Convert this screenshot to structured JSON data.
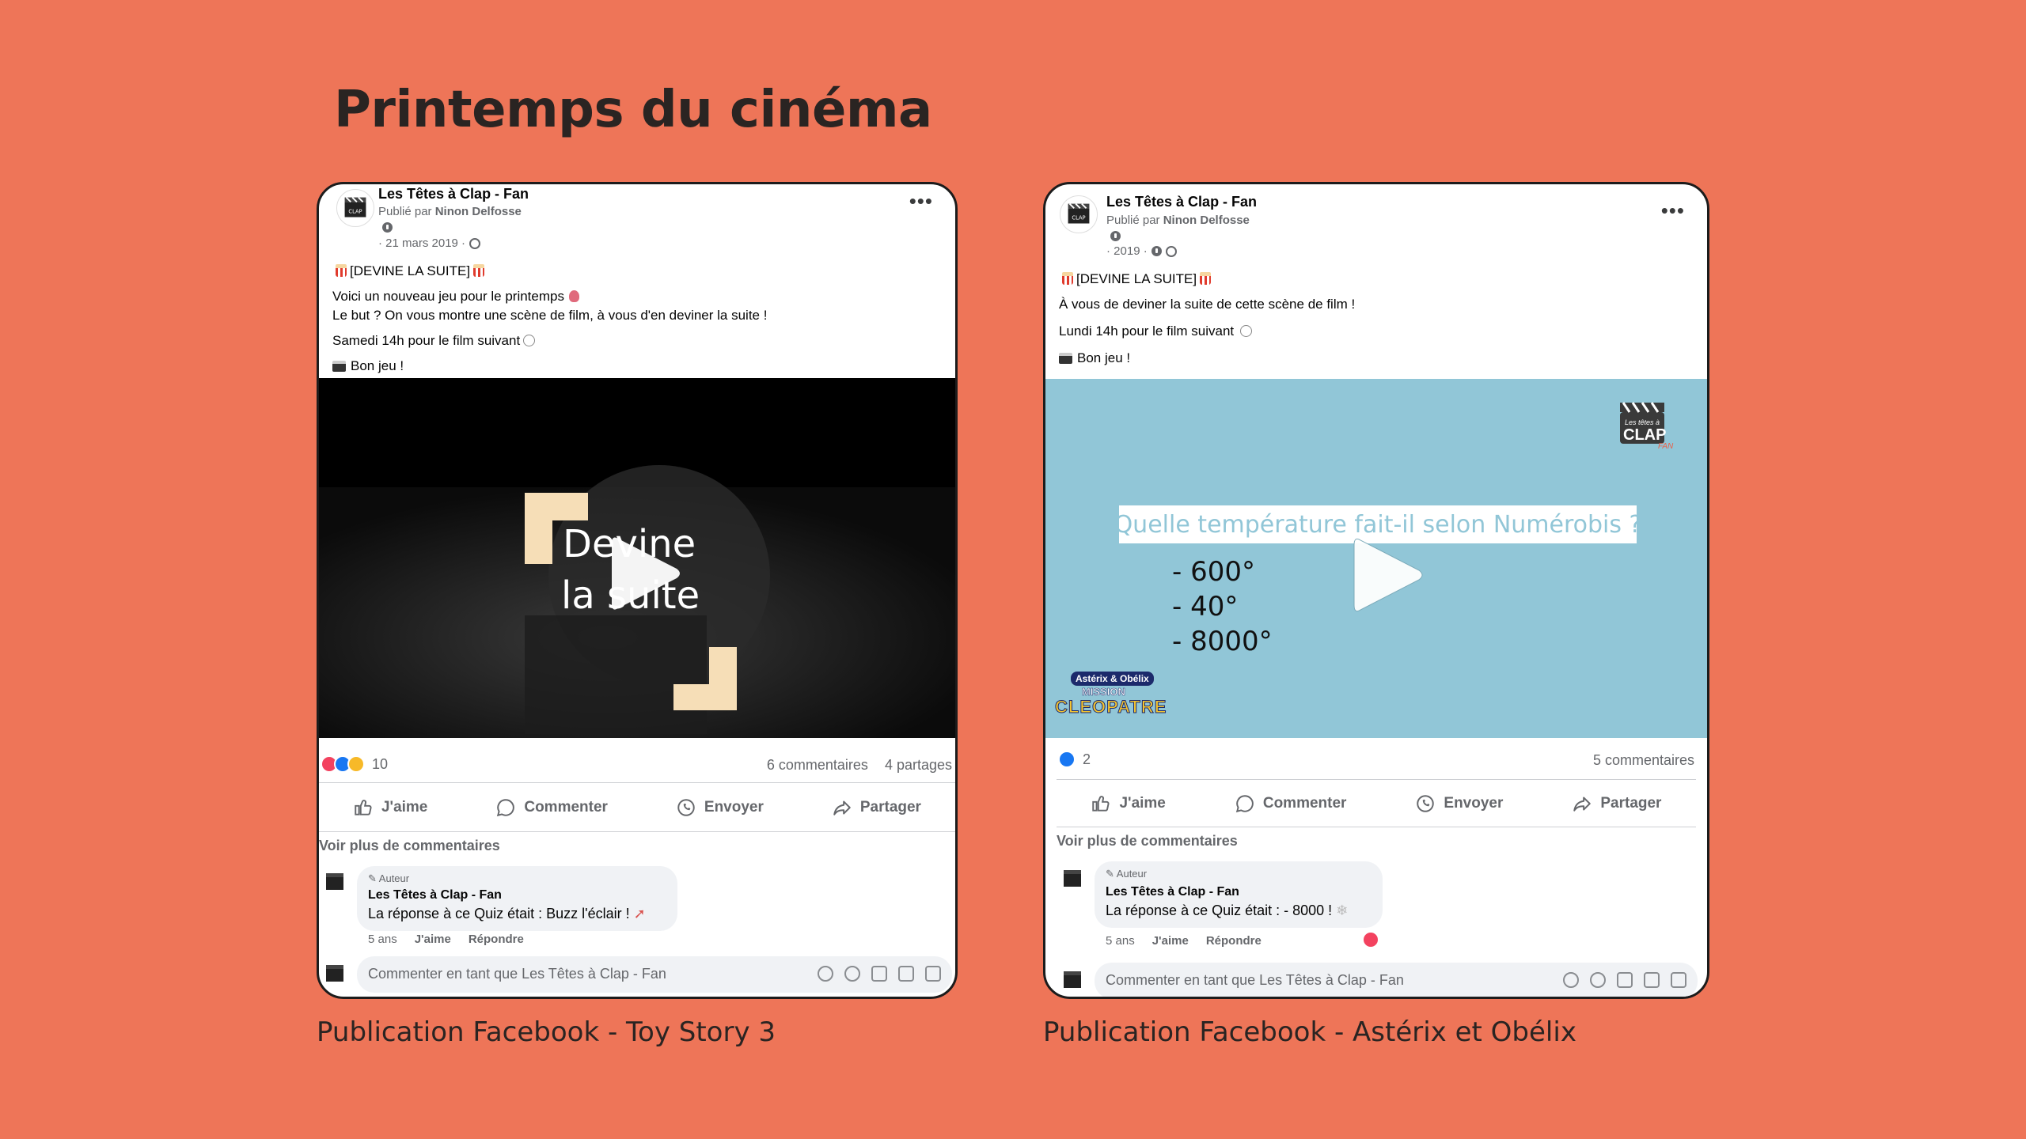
{
  "page": {
    "title": "Printemps du cinéma",
    "captions": [
      "Publication Facebook - Toy Story 3",
      "Publication Facebook - Astérix et Obélix"
    ]
  },
  "colors": {
    "background": "#EE7558",
    "fb_like_blue": "#1877F2",
    "fb_love_red": "#F3425F",
    "video2_bg": "#91C6D7",
    "highlight_beige": "#F6DEB7"
  },
  "posts": [
    {
      "page_name": "Les Têtes à Clap - Fan",
      "published_prefix": "Publié par",
      "published_by": "Ninon Delfosse",
      "date": "· 21 mars 2019 ·",
      "lines": [
        "[DEVINE LA SUITE]",
        "Voici un nouveau jeu pour le printemps",
        "Le but ? On vous montre une scène de film, à vous d'en deviner la suite !",
        "Samedi 14h pour le film suivant",
        "Bon jeu !"
      ],
      "video": {
        "title_line1": "Devine",
        "title_line2": "la suite",
        "play_icon": "play-icon"
      },
      "reaction_count": "10",
      "comments_count": "6 commentaires",
      "shares_count": "4 partages",
      "actions": [
        "J'aime",
        "Commenter",
        "Envoyer",
        "Partager"
      ],
      "more_comments": "Voir plus de commentaires",
      "comment": {
        "author_tag": "Auteur",
        "name": "Les Têtes à Clap - Fan",
        "text": "La réponse à ce Quiz était : Buzz l'éclair !",
        "age": "5 ans",
        "like": "J'aime",
        "reply": "Répondre"
      },
      "input_placeholder": "Commenter en tant que Les Têtes à Clap - Fan"
    },
    {
      "page_name": "Les Têtes à Clap - Fan",
      "published_prefix": "Publié par",
      "published_by": "Ninon Delfosse",
      "date": "· 2019 ·",
      "lines": [
        "[DEVINE LA SUITE]",
        "À vous de deviner la suite de cette scène de film !",
        "Lundi 14h pour le film suivant",
        "Bon jeu !"
      ],
      "video": {
        "question": "Quelle température fait-il selon Numérobis ?",
        "answers": [
          "- 600°",
          "- 40°",
          "- 8000°"
        ],
        "logo_text": "CLAP",
        "logo_sub": "Les têtes à",
        "logo_fan": "FAN",
        "movie_logo_line1": "Astérix & Obélix",
        "movie_logo_line2": "MISSION",
        "movie_logo_line3": "CLEOPATRE"
      },
      "reaction_count": "2",
      "comments_count": "5 commentaires",
      "actions": [
        "J'aime",
        "Commenter",
        "Envoyer",
        "Partager"
      ],
      "more_comments": "Voir plus de commentaires",
      "comment": {
        "author_tag": "Auteur",
        "name": "Les Têtes à Clap - Fan",
        "text": "La réponse à ce Quiz était : - 8000 !",
        "age": "5 ans",
        "like": "J'aime",
        "reply": "Répondre"
      },
      "input_placeholder": "Commenter en tant que Les Têtes à Clap - Fan"
    }
  ]
}
